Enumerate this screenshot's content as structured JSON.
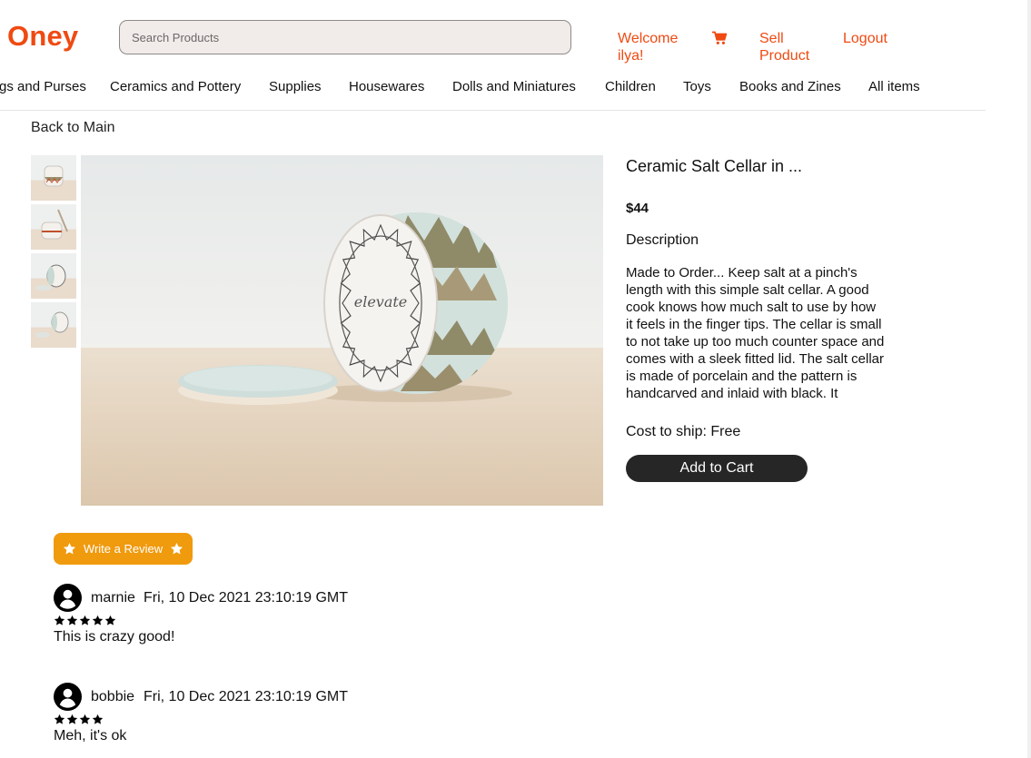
{
  "header": {
    "logo": "Oney",
    "search_placeholder": "Search Products",
    "welcome": "Welcome ilya!",
    "cart_icon": "shopping-cart-icon",
    "sell": "Sell Product",
    "logout": "Logout"
  },
  "categories": [
    "gs and Purses",
    "Ceramics and Pottery",
    "Supplies",
    "Housewares",
    "Dolls and Miniatures",
    "Children",
    "Toys",
    "Books and Zines",
    "All items"
  ],
  "nav": {
    "back": "Back to Main"
  },
  "product": {
    "title": "Ceramic Salt Cellar in ...",
    "price": "$44",
    "description_heading": "Description",
    "description": "Made to Order... Keep salt at a pinch's length with this simple salt cellar. A good cook knows how much salt to use by how it feels in the finger tips. The cellar is small to not take up too much counter space and comes with a sleek fitted lid. The salt cellar is made of porcelain and the pattern is handcarved and inlaid with black. It",
    "shipping": "Cost to ship: Free",
    "add_to_cart": "Add to Cart",
    "image_count": 4,
    "stamp": "elevate"
  },
  "reviews": {
    "write_label": "Write a Review",
    "items": [
      {
        "name": "marnie",
        "date": "Fri, 10 Dec 2021 23:10:19 GMT",
        "rating": 5,
        "text": "This is crazy good!"
      },
      {
        "name": "bobbie",
        "date": "Fri, 10 Dec 2021 23:10:19 GMT",
        "rating": 4,
        "text": "Meh, it's ok"
      }
    ]
  },
  "colors": {
    "brand": "#ef4a12",
    "review_button": "#f09a0e",
    "cart_button": "#262626"
  }
}
